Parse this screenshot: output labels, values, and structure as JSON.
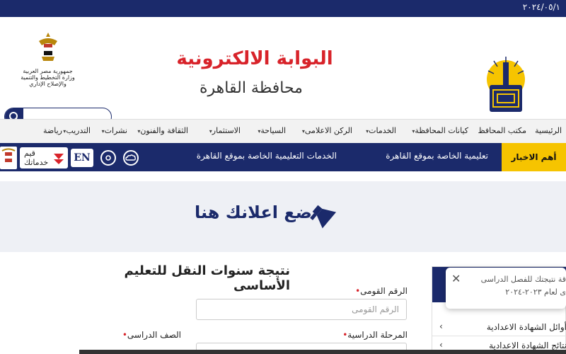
{
  "topbar": {
    "date": "٢٠٢٤/٠٥/١"
  },
  "header": {
    "title": "البوابة الالكترونية",
    "subtitle": "محافظة القاهرة",
    "gov_line1": "جمهورية مصر العربية",
    "gov_line2": "وزارة التخطيط والتنمية والإصلاح الإداري",
    "search_placeholder": ""
  },
  "nav": {
    "items": [
      {
        "label": "الرئيسية",
        "dropdown": false
      },
      {
        "label": "مكتب المحافظ",
        "dropdown": false
      },
      {
        "label": "كيانات المحافظة",
        "dropdown": true
      },
      {
        "label": "الخدمات",
        "dropdown": true
      },
      {
        "label": "الركن الاعلامى",
        "dropdown": true
      },
      {
        "label": "السياحة",
        "dropdown": true
      },
      {
        "label": "الاستثمار",
        "dropdown": true
      },
      {
        "label": "الثقافة والفنون",
        "dropdown": true
      },
      {
        "label": "نشرات",
        "dropdown": true
      },
      {
        "label": "التدريب",
        "dropdown": true
      },
      {
        "label": "رياضة",
        "dropdown": false
      }
    ]
  },
  "news": {
    "label": "أهم الاخبار",
    "ticker1": "تعليمية الخاصة بموقع القاهرة",
    "ticker2": "الخدمات التعليمية الخاصة بموقع القاهرة",
    "en_label": "EN",
    "qayyem_line1": "قيم",
    "qayyem_line2": "خدماتك"
  },
  "ad": {
    "text": "ضع اعلانك هنا"
  },
  "form": {
    "title": "نتيجة سنوات النقل للتعليم الأساسى",
    "national_id_label": "الرقم القومى",
    "national_id_placeholder": "الرقم القومى",
    "stage_label": "المرحلة الدراسية",
    "grade_label": "الصف الدراسى"
  },
  "sidebar": {
    "items": [
      "أوائل الشهادة الاعدادية",
      "نتائج الشهادة الاعدادية"
    ]
  },
  "toast": {
    "line1": "قة نتيجتك للفصل الدراسى",
    "line2": "ى لعام ٢٠٢٣-٢٠٢٤"
  },
  "colors": {
    "navy": "#1b2a6b",
    "red": "#d8232a",
    "yellow": "#f6c400"
  }
}
